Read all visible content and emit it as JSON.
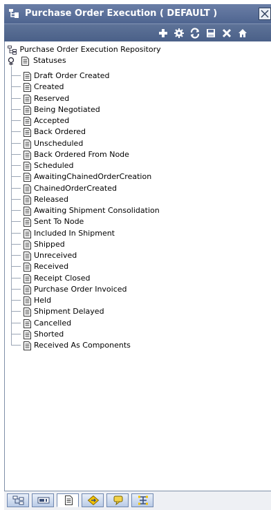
{
  "window": {
    "title": "Purchase Order Execution ( DEFAULT )",
    "icons": {
      "title": "tree-view-icon",
      "close": "close-icon"
    }
  },
  "toolbar": {
    "buttons": [
      {
        "name": "add-button",
        "icon": "plus-icon"
      },
      {
        "name": "details-button",
        "icon": "gear-icon"
      },
      {
        "name": "refresh-button",
        "icon": "refresh-icon"
      },
      {
        "name": "save-button",
        "icon": "save-icon"
      },
      {
        "name": "delete-button",
        "icon": "x-icon"
      },
      {
        "name": "home-button",
        "icon": "home-icon"
      }
    ]
  },
  "tree": {
    "root": "Purchase Order Execution Repository",
    "folder": "Statuses",
    "items": [
      "Draft Order Created",
      "Created",
      "Reserved",
      "Being Negotiated",
      "Accepted",
      "Back Ordered",
      "Unscheduled",
      "Back Ordered From Node",
      "Scheduled",
      "AwaitingChainedOrderCreation",
      "ChainedOrderCreated",
      "Released",
      "Awaiting Shipment Consolidation",
      "Sent To Node",
      "Included In Shipment",
      "Shipped",
      "Unreceived",
      "Received",
      "Receipt Closed",
      "Purchase Order Invoiced",
      "Held",
      "Shipment Delayed",
      "Cancelled",
      "Shorted",
      "Received As Components"
    ]
  },
  "tabs": [
    {
      "name": "tab-tree",
      "icon": "tree-icon"
    },
    {
      "name": "tab-properties",
      "icon": "panel-icon"
    },
    {
      "name": "tab-documents",
      "icon": "document-icon",
      "active": true
    },
    {
      "name": "tab-rules",
      "icon": "diamond-icon"
    },
    {
      "name": "tab-alerts",
      "icon": "bell-icon"
    },
    {
      "name": "tab-network",
      "icon": "network-icon"
    }
  ],
  "colors": {
    "titlebar": "#5a6f99",
    "toolbar_icons": "#ffffff",
    "tab_border": "#6f87b0"
  }
}
